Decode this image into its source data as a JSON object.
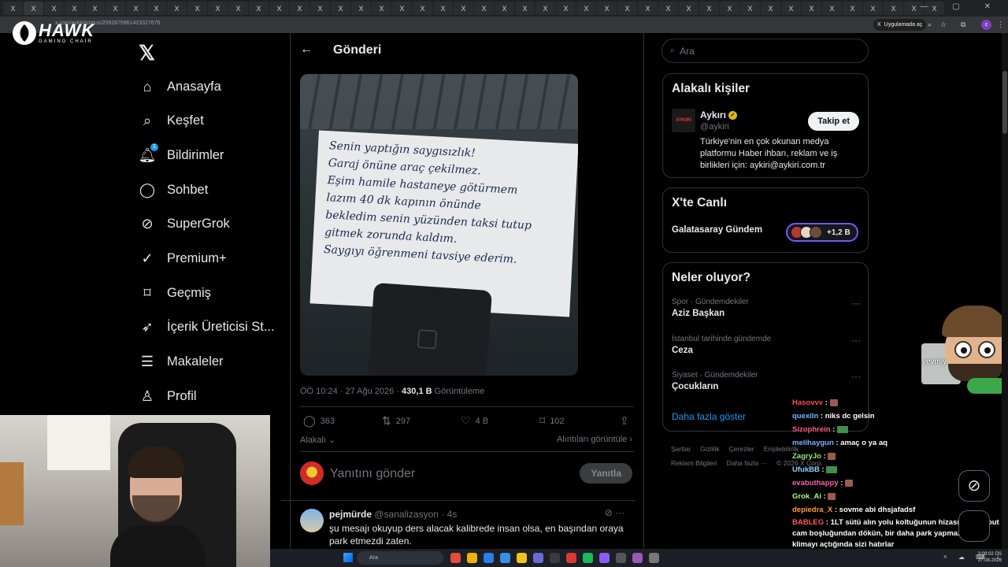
{
  "browser": {
    "tab_glyph": "X",
    "url": "x.com/aykiri/status/2092875961423327676",
    "open_in_app": "Uygulamada aç"
  },
  "overlay": {
    "brand": "HAWK",
    "brand_sub": "GAMING CHAIR",
    "mascot_label": "yevmiye"
  },
  "nav": {
    "items": [
      {
        "label": "Anasayfa",
        "icon": "home-icon"
      },
      {
        "label": "Keşfet",
        "icon": "search-icon"
      },
      {
        "label": "Bildirimler",
        "icon": "bell-icon",
        "badge": "1"
      },
      {
        "label": "Sohbet",
        "icon": "chat-icon"
      },
      {
        "label": "SuperGrok",
        "icon": "grok-icon"
      },
      {
        "label": "Premium+",
        "icon": "verified-icon"
      },
      {
        "label": "Geçmiş",
        "icon": "bookmark-icon"
      },
      {
        "label": "İçerik Üreticisi St...",
        "icon": "rocket-icon"
      },
      {
        "label": "Makaleler",
        "icon": "article-icon"
      },
      {
        "label": "Profil",
        "icon": "profile-icon"
      }
    ]
  },
  "post": {
    "header_title": "Gönderi",
    "note_lines": [
      "Senin yaptığın saygısızlık!",
      "Garaj önüne araç çekilmez.",
      "Eşim hamile hastaneye götürmem",
      "lazım 40 dk kapının önünde",
      "bekledim senin yüzünden taksi tutup",
      "gitmek zorunda kaldım.",
      "Saygıyı öğrenmeni tavsiye ederim."
    ],
    "time": "ÖÖ 10:24 · 27 Ağu 2026 ·",
    "views_value": "430,1 B",
    "views_label": "Görüntüleme",
    "replies": "363",
    "reposts": "297",
    "likes": "4 B",
    "bookmarks": "102",
    "related": "Alakalı",
    "quotes": "Alıntıları görüntüle",
    "reply_placeholder": "Yanıtını gönder",
    "reply_button": "Yanıtla"
  },
  "comment": {
    "name": "pejmürde",
    "handle": "@sanalizasyon · 4s",
    "text": "şu mesajı okuyup ders alacak kalibrede insan olsa, en başından oraya park etmezdi zaten."
  },
  "sidebar": {
    "search_placeholder": "Ara",
    "related_title": "Alakalı kişiler",
    "account": {
      "avatar_text": "AYKIRI",
      "name": "Aykırı",
      "handle": "@aykiri",
      "follow": "Takip et",
      "bio": "Türkiye'nin en çok okunan medya platformu Haber ihbarı, reklam ve iş birlikleri için: aykiri@aykiri.com.tr"
    },
    "live_title": "X'te Canlı",
    "live_topic": "Galatasaray Gündem",
    "live_count": "+1,2 B",
    "trends_title": "Neler oluyor?",
    "trends": [
      {
        "meta": "Spor · Gündemdekiler",
        "name": "Aziz Başkan"
      },
      {
        "meta": "İstanbul tarihinde gündemde",
        "name": "Ceza"
      },
      {
        "meta": "Siyaset · Gündemdekiler",
        "name": "Çocukların"
      }
    ],
    "show_more": "Daha fazla göster",
    "footer_row1": [
      "Şartlar",
      "Gizlilik",
      "Çerezler",
      "Erişilebilirlik"
    ],
    "footer_row2": [
      "Reklam Bilgileri",
      "Daha fazla ···",
      "© 2026 X Corp."
    ]
  },
  "chat": [
    {
      "user": "Hasovvv",
      "color": "#ff4d4d",
      "msg": ""
    },
    {
      "user": "quexiln",
      "color": "#6fb8ff",
      "msg": "niks dc gelsin"
    },
    {
      "user": "Sizophrein",
      "color": "#ff5c8a",
      "msg": ""
    },
    {
      "user": "melihaygun",
      "color": "#7fb0ff",
      "msg": "amaç o ya aq"
    },
    {
      "user": "ZagryJo",
      "color": "#9fe870",
      "msg": ""
    },
    {
      "user": "UfukBB",
      "color": "#8fd3ff",
      "msg": ""
    },
    {
      "user": "evabuthappy",
      "color": "#ff5da8",
      "msg": ""
    },
    {
      "user": "Grok_Ai",
      "color": "#a6ff7a",
      "msg": ""
    },
    {
      "user": "depiedra_X",
      "color": "#ff9b3d",
      "msg": "sovme abi dhsjafadsf"
    },
    {
      "user": "BABLEG",
      "color": "#ff5c5c",
      "msg": "1LT sütü alın yolu koltuğunun hizasından kaput cam boşluğundan dökün, bir daha park yapmaz ve her klimayı açtığında sizi hatırlar"
    },
    {
      "user": "Sizophrein",
      "color": "#ff5c8a",
      "msg": ""
    }
  ],
  "taskbar": {
    "search": "Ara",
    "time": "3:09:02 ÖS",
    "date": "27.08.2026"
  },
  "colors": {
    "accent": "#1d9bf0",
    "background": "#000000",
    "border": "#2f3336",
    "muted_text": "#71767b"
  }
}
